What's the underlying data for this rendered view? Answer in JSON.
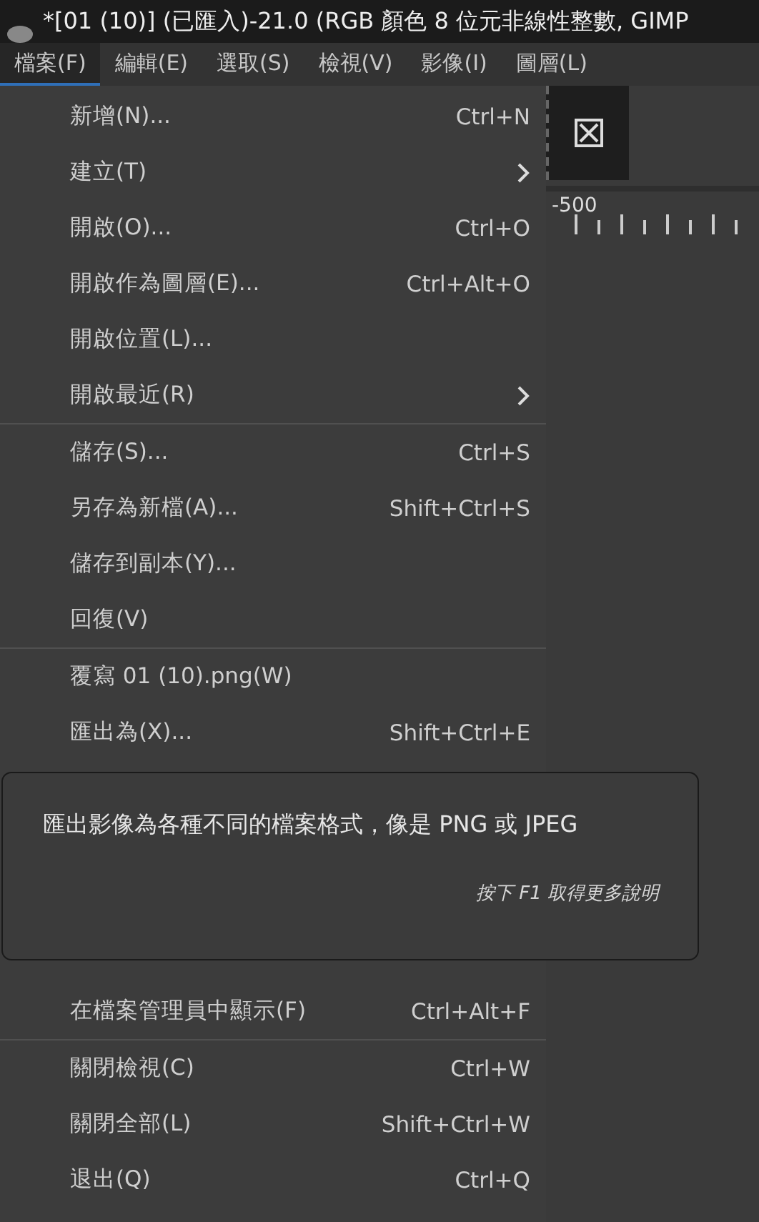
{
  "window": {
    "title": "*[01 (10)] (已匯入)-21.0 (RGB 顏色 8 位元非線性整數, GIMP"
  },
  "menubar": [
    {
      "label": "檔案(F)",
      "selected": true
    },
    {
      "label": "編輯(E)",
      "selected": false
    },
    {
      "label": "選取(S)",
      "selected": false
    },
    {
      "label": "檢視(V)",
      "selected": false
    },
    {
      "label": "影像(I)",
      "selected": false
    },
    {
      "label": "圖層(L)",
      "selected": false
    }
  ],
  "menu": [
    {
      "kind": "item",
      "label": "新增(N)...",
      "shortcut": "Ctrl+N"
    },
    {
      "kind": "submenu",
      "label": "建立(T)"
    },
    {
      "kind": "item",
      "label": "開啟(O)...",
      "shortcut": "Ctrl+O"
    },
    {
      "kind": "item",
      "label": "開啟作為圖層(E)...",
      "shortcut": "Ctrl+Alt+O"
    },
    {
      "kind": "item",
      "label": "開啟位置(L)..."
    },
    {
      "kind": "submenu",
      "label": "開啟最近(R)"
    },
    {
      "kind": "separator"
    },
    {
      "kind": "item",
      "label": "儲存(S)...",
      "shortcut": "Ctrl+S"
    },
    {
      "kind": "item",
      "label": "另存為新檔(A)...",
      "shortcut": "Shift+Ctrl+S"
    },
    {
      "kind": "item",
      "label": "儲存到副本(Y)..."
    },
    {
      "kind": "item",
      "label": "回復(V)"
    },
    {
      "kind": "separator"
    },
    {
      "kind": "item",
      "label": "覆寫 01 (10).png(W)"
    },
    {
      "kind": "item",
      "label": "匯出為(X)...",
      "shortcut": "Shift+Ctrl+E"
    },
    {
      "kind": "hidden"
    },
    {
      "kind": "item",
      "label": "在檔案管理員中顯示(F)",
      "shortcut": "Ctrl+Alt+F"
    },
    {
      "kind": "separator"
    },
    {
      "kind": "item",
      "label": "關閉檢視(C)",
      "shortcut": "Ctrl+W"
    },
    {
      "kind": "item",
      "label": "關閉全部(L)",
      "shortcut": "Shift+Ctrl+W"
    },
    {
      "kind": "item",
      "label": "退出(Q)",
      "shortcut": "Ctrl+Q"
    }
  ],
  "tooltip": {
    "text": "匯出影像為各種不同的檔案格式，像是 PNG 或 JPEG",
    "hint": "按下 F1 取得更多說明"
  },
  "ruler": {
    "label": "-500"
  }
}
